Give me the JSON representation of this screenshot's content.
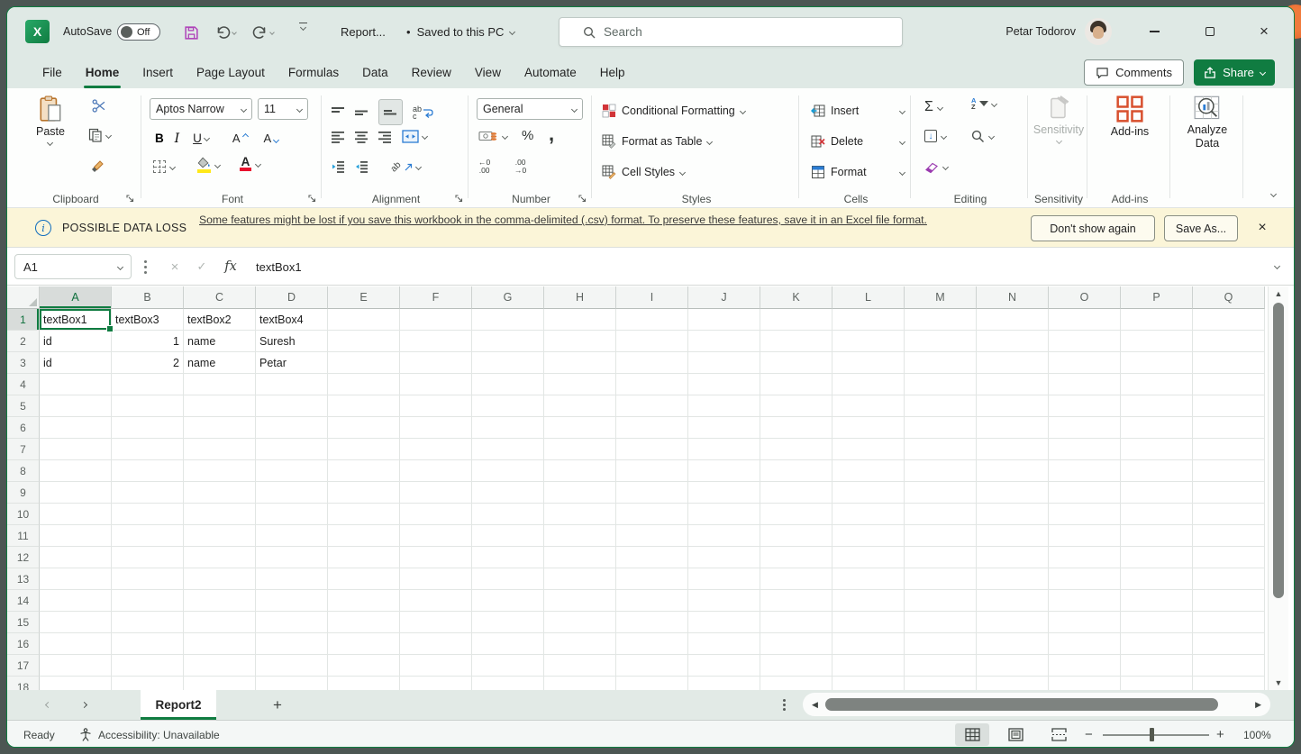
{
  "titlebar": {
    "autosave_label": "AutoSave",
    "autosave_state": "Off",
    "doc_name": "Report...",
    "bullet": "•",
    "saved_status": "Saved to this PC",
    "search_placeholder": "Search",
    "user_name": "Petar Todorov"
  },
  "ribbon_tabs": {
    "items": [
      "File",
      "Home",
      "Insert",
      "Page Layout",
      "Formulas",
      "Data",
      "Review",
      "View",
      "Automate",
      "Help"
    ],
    "active": "Home",
    "comments_label": "Comments",
    "share_label": "Share"
  },
  "ribbon": {
    "clipboard": {
      "label": "Clipboard",
      "paste_label": "Paste"
    },
    "font": {
      "label": "Font",
      "name": "Aptos Narrow",
      "size": "11",
      "bold": "B",
      "italic": "I",
      "underline": "U",
      "grow": "A",
      "shrink": "A"
    },
    "alignment": {
      "label": "Alignment",
      "wrap_top": "ab",
      "wrap_bottom": "c",
      "orientation_text": "ab"
    },
    "number": {
      "label": "Number",
      "format": "General",
      "percent": "%",
      "comma": ",",
      "dec_top": "←0",
      "dec_bottom": ".00",
      "inc_top": ".00",
      "inc_bottom": "→0"
    },
    "styles": {
      "label": "Styles",
      "items": [
        "Conditional Formatting",
        "Format as Table",
        "Cell Styles"
      ]
    },
    "cells": {
      "label": "Cells",
      "items": [
        "Insert",
        "Delete",
        "Format"
      ]
    },
    "editing": {
      "label": "Editing",
      "autosum": "Σ",
      "sort_a": "A",
      "sort_z": "Z",
      "fill_arrow": "↓"
    },
    "sensitivity": {
      "label": "Sensitivity",
      "button_label": "Sensitivity"
    },
    "addins": {
      "label": "Add-ins",
      "button_label": "Add-ins"
    },
    "analyze": {
      "button_label": "Analyze Data"
    }
  },
  "message_bar": {
    "title": "POSSIBLE DATA LOSS",
    "info_glyph": "i",
    "message": "Some features might be lost if you save this workbook in the comma-delimited (.csv) format. To preserve these features, save it in an Excel file format.",
    "dont_show_label": "Don't show again",
    "save_as_label": "Save As...",
    "close_glyph": "×"
  },
  "formula_bar": {
    "name_box": "A1",
    "cancel_glyph": "×",
    "enter_glyph": "✓",
    "fx": "fx",
    "content": "textBox1"
  },
  "grid": {
    "columns": [
      "A",
      "B",
      "C",
      "D",
      "E",
      "F",
      "G",
      "H",
      "I",
      "J",
      "K",
      "L",
      "M",
      "N",
      "O",
      "P",
      "Q"
    ],
    "visible_rows": 18,
    "selected_cell": "A1",
    "selected_col": "A",
    "selected_row": 1,
    "right_aligned": [
      "B2",
      "B3"
    ],
    "cells": {
      "A1": "textBox1",
      "B1": "textBox3",
      "C1": "textBox2",
      "D1": "textBox4",
      "A2": "id",
      "B2": "1",
      "C2": "name",
      "D2": "Suresh",
      "A3": "id",
      "B3": "2",
      "C3": "name",
      "D3": "Petar"
    }
  },
  "sheet_bar": {
    "active_tab": "Report2"
  },
  "status_bar": {
    "ready": "Ready",
    "accessibility": "Accessibility: Unavailable",
    "zoom_level": "100%"
  },
  "glyphs": {
    "excel_x": "X",
    "plus_char": "+",
    "minus_char": "−",
    "tri_left": "◀",
    "tri_right": "▶",
    "tri_up": "▲",
    "tri_down": "▼"
  },
  "colors": {
    "excel_green": "#107C41",
    "warning_bg": "#FBF5D8",
    "brave_orange": "#E8622C",
    "save_icon_purple": "#AE3FB8"
  }
}
